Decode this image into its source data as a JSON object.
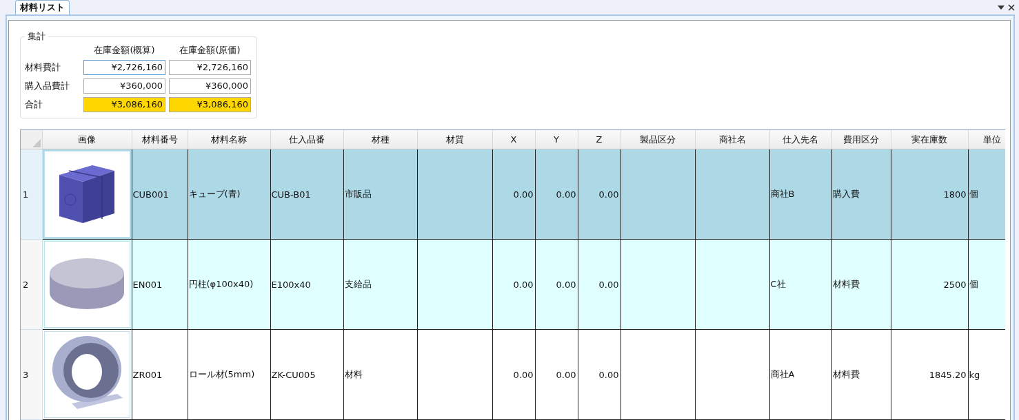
{
  "tab": {
    "label": "材料リスト"
  },
  "summary": {
    "title": "集計",
    "columns": [
      "在庫金額(概算)",
      "在庫金額(原価)"
    ],
    "rows": [
      {
        "label": "材料費計",
        "highlighted": false,
        "values": [
          {
            "text": "¥2,726,160",
            "focused": true
          },
          {
            "text": "¥2,726,160",
            "focused": false
          }
        ]
      },
      {
        "label": "購入品費計",
        "highlighted": false,
        "values": [
          {
            "text": "¥360,000",
            "focused": false
          },
          {
            "text": "¥360,000",
            "focused": false
          }
        ]
      },
      {
        "label": "合計",
        "highlighted": true,
        "values": [
          {
            "text": "¥3,086,160",
            "focused": false
          },
          {
            "text": "¥3,086,160",
            "focused": false
          }
        ]
      }
    ]
  },
  "table": {
    "columns": [
      {
        "label": "画像",
        "kind": "image"
      },
      {
        "label": "材料番号",
        "kind": "text"
      },
      {
        "label": "材料名称",
        "kind": "text"
      },
      {
        "label": "仕入品番",
        "kind": "text"
      },
      {
        "label": "材種",
        "kind": "text"
      },
      {
        "label": "材質",
        "kind": "text"
      },
      {
        "label": "X",
        "kind": "number"
      },
      {
        "label": "Y",
        "kind": "number"
      },
      {
        "label": "Z",
        "kind": "number"
      },
      {
        "label": "製品区分",
        "kind": "text"
      },
      {
        "label": "商社名",
        "kind": "text"
      },
      {
        "label": "仕入先名",
        "kind": "text"
      },
      {
        "label": "費用区分",
        "kind": "text"
      },
      {
        "label": "実在庫数",
        "kind": "number"
      },
      {
        "label": "単位",
        "kind": "text"
      }
    ],
    "rows": [
      {
        "number": "1",
        "selected": true,
        "kind": "cube",
        "cells": [
          null,
          "CUB001",
          "キューブ(青)",
          "CUB-B01",
          "市販品",
          null,
          "0.00",
          "0.00",
          "0.00",
          null,
          null,
          "商社B",
          "購入費",
          "1800",
          "個"
        ]
      },
      {
        "number": "2",
        "selected": false,
        "kind": "cylinder",
        "cells": [
          null,
          "EN001",
          "円柱(φ100x40)",
          "E100x40",
          "支給品",
          null,
          "0.00",
          "0.00",
          "0.00",
          null,
          null,
          "C社",
          "材料費",
          "2500",
          "個"
        ]
      },
      {
        "number": "3",
        "selected": false,
        "kind": "roll",
        "cells": [
          null,
          "ZR001",
          "ロール材(5mm)",
          "ZK-CU005",
          "材料",
          null,
          "0.00",
          "0.00",
          "0.00",
          null,
          null,
          "商社A",
          "材料費",
          "1845.20",
          "kg"
        ]
      }
    ]
  }
}
